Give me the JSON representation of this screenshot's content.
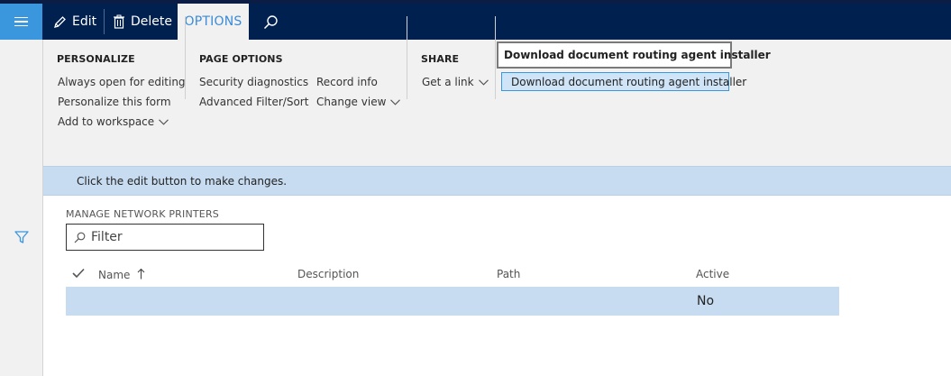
{
  "topbar": {
    "edit_label": "Edit",
    "delete_label": "Delete",
    "options_tab": "OPTIONS"
  },
  "ribbon": {
    "personalize": {
      "title": "PERSONALIZE",
      "items": [
        "Always open for editing",
        "Personalize this form",
        "Add to workspace"
      ]
    },
    "page_options": {
      "title": "PAGE OPTIONS",
      "col1": [
        "Security diagnostics",
        "Advanced Filter/Sort"
      ],
      "col2": [
        "Record info",
        "Change view"
      ]
    },
    "share": {
      "title": "SHARE",
      "items": [
        "Get a link"
      ]
    },
    "tooltip": "Download document routing agent installer",
    "download_button": "Download document routing agent installer"
  },
  "message_bar": "Click the edit button to make changes.",
  "content": {
    "section_title": "MANAGE NETWORK PRINTERS",
    "filter_placeholder": "Filter",
    "columns": [
      "Name",
      "Description",
      "Path",
      "Active"
    ],
    "rows": [
      {
        "name": "",
        "description": "",
        "path": "",
        "active": "No"
      }
    ]
  },
  "colors": {
    "nav_dark": "#002050",
    "accent_blue": "#3a96dd",
    "ribbon_bg": "#f1f1f1",
    "selection_blue": "#c7dcf1"
  }
}
